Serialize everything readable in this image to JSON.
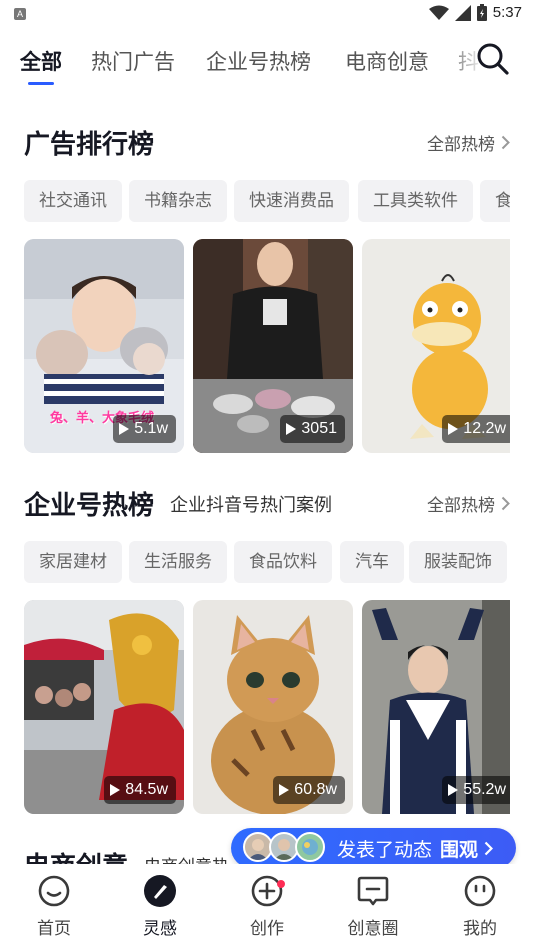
{
  "status_bar": {
    "time": "5:37",
    "left_icon": "A"
  },
  "top_tabs": {
    "items": [
      "全部",
      "热门广告",
      "企业号热榜",
      "电商创意",
      "抖"
    ],
    "active_index": 0,
    "accent": "#2a5cff"
  },
  "ad_ranking": {
    "title": "广告排行榜",
    "more_label": "全部热榜",
    "chips": [
      "社交通讯",
      "书籍杂志",
      "快速消费品",
      "工具类软件",
      "食"
    ],
    "cards": [
      {
        "plays": "5.1w",
        "caption": "兔、羊、大象毛绒"
      },
      {
        "plays": "3051"
      },
      {
        "plays": "12.2w"
      }
    ]
  },
  "enterprise_ranking": {
    "title": "企业号热榜",
    "subtitle": "企业抖音号热门案例",
    "more_label": "全部热榜",
    "chips": [
      "家居建材",
      "生活服务",
      "食品饮料",
      "汽车",
      "服装配饰"
    ],
    "cards": [
      {
        "plays": "84.5w"
      },
      {
        "plays": "60.8w"
      },
      {
        "plays": "55.2w"
      }
    ]
  },
  "ecommerce": {
    "title": "电商创意",
    "subtitle": "电商创意热"
  },
  "activity_pill": {
    "text": "发表了动态",
    "cta": "围观"
  },
  "bottom_nav": {
    "items": [
      "首页",
      "灵感",
      "创作",
      "创意圈",
      "我的"
    ],
    "active_index": 1
  }
}
